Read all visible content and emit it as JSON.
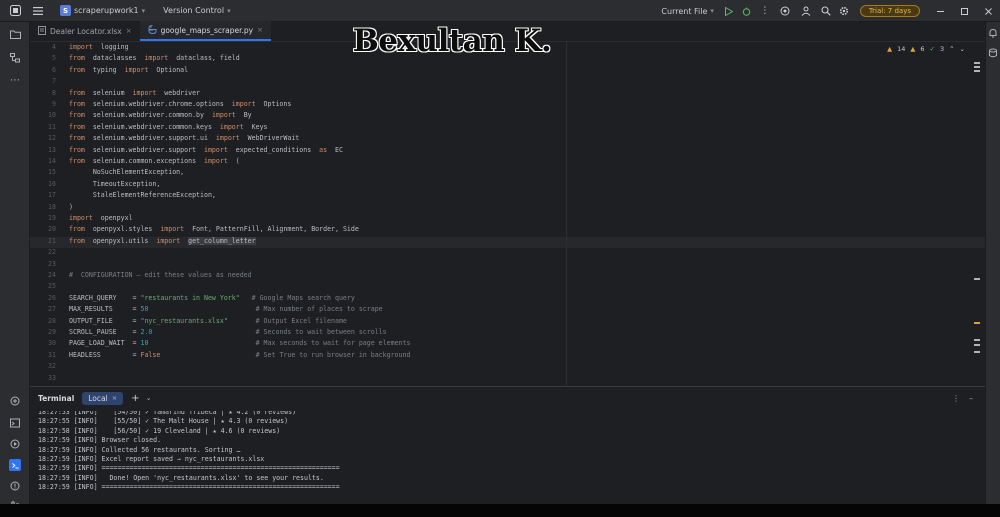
{
  "titlebar": {
    "project_badge": "S",
    "project_name": "scraperupwork1",
    "vcs_label": "Version Control",
    "run_config": "Current File",
    "trial_label": "Trial: 7 days",
    "icons": [
      "hamburger-menu-icon",
      "run-icon",
      "debug-icon",
      "more-icon",
      "ai-assistant-icon",
      "account-icon",
      "search-icon",
      "settings-icon",
      "minimize-icon",
      "maximize-icon",
      "close-icon"
    ]
  },
  "tabs": [
    {
      "label": "Dealer Locator.xlsx",
      "active": false
    },
    {
      "label": "google_maps_scraper.py",
      "active": true
    }
  ],
  "editor": {
    "inspections": {
      "warnings": "14",
      "weak": "6",
      "ok": "3"
    },
    "lines": [
      {
        "n": "4",
        "parts": [
          [
            "kw",
            "import"
          ],
          [
            "",
            "  logging"
          ]
        ]
      },
      {
        "n": "5",
        "parts": [
          [
            "kw",
            "from"
          ],
          [
            "",
            "  dataclasses  "
          ],
          [
            "kw",
            "import"
          ],
          [
            "",
            "  dataclass, field"
          ]
        ]
      },
      {
        "n": "6",
        "parts": [
          [
            "kw",
            "from"
          ],
          [
            "",
            "  typing  "
          ],
          [
            "kw",
            "import"
          ],
          [
            "",
            "  Optional"
          ]
        ]
      },
      {
        "n": "7",
        "parts": []
      },
      {
        "n": "8",
        "parts": [
          [
            "kw",
            "from"
          ],
          [
            "",
            "  selenium  "
          ],
          [
            "kw",
            "import"
          ],
          [
            "",
            "  webdriver"
          ]
        ]
      },
      {
        "n": "9",
        "parts": [
          [
            "kw",
            "from"
          ],
          [
            "",
            "  selenium.webdriver.chrome.options  "
          ],
          [
            "kw",
            "import"
          ],
          [
            "",
            "  Options"
          ]
        ]
      },
      {
        "n": "10",
        "parts": [
          [
            "kw",
            "from"
          ],
          [
            "",
            "  selenium.webdriver.common.by  "
          ],
          [
            "kw",
            "import"
          ],
          [
            "",
            "  By"
          ]
        ]
      },
      {
        "n": "11",
        "parts": [
          [
            "kw",
            "from"
          ],
          [
            "",
            "  selenium.webdriver.common.keys  "
          ],
          [
            "kw",
            "import"
          ],
          [
            "",
            "  Keys"
          ]
        ]
      },
      {
        "n": "12",
        "parts": [
          [
            "kw",
            "from"
          ],
          [
            "",
            "  selenium.webdriver.support.ui  "
          ],
          [
            "kw",
            "import"
          ],
          [
            "",
            "  WebDriverWait"
          ]
        ]
      },
      {
        "n": "13",
        "parts": [
          [
            "kw",
            "from"
          ],
          [
            "",
            "  selenium.webdriver.support  "
          ],
          [
            "kw",
            "import"
          ],
          [
            "",
            "  expected_conditions  "
          ],
          [
            "kw",
            "as"
          ],
          [
            "",
            "  EC"
          ]
        ]
      },
      {
        "n": "14",
        "parts": [
          [
            "kw",
            "from"
          ],
          [
            "",
            "  selenium.common.exceptions  "
          ],
          [
            "kw",
            "import"
          ],
          [
            "",
            "  ("
          ]
        ]
      },
      {
        "n": "15",
        "parts": [
          [
            "",
            "      NoSuchElementException,"
          ]
        ]
      },
      {
        "n": "16",
        "parts": [
          [
            "",
            "      TimeoutException,"
          ]
        ]
      },
      {
        "n": "17",
        "parts": [
          [
            "",
            "      StaleElementReferenceException,"
          ]
        ]
      },
      {
        "n": "18",
        "parts": [
          [
            "",
            ")"
          ]
        ]
      },
      {
        "n": "19",
        "parts": [
          [
            "kw",
            "import"
          ],
          [
            "",
            "  openpyxl"
          ]
        ]
      },
      {
        "n": "20",
        "parts": [
          [
            "kw",
            "from"
          ],
          [
            "",
            "  openpyxl.styles  "
          ],
          [
            "kw",
            "import"
          ],
          [
            "",
            "  Font, PatternFill, Alignment, Border, Side"
          ]
        ]
      },
      {
        "n": "21",
        "parts": [
          [
            "kw",
            "from"
          ],
          [
            "",
            "  openpyxl.utils  "
          ],
          [
            "kw",
            "import"
          ],
          [
            "",
            "  "
          ],
          [
            "hl",
            "get_column_letter"
          ]
        ]
      },
      {
        "n": "22",
        "parts": []
      },
      {
        "n": "23",
        "parts": []
      },
      {
        "n": "24",
        "parts": [
          [
            "cm",
            "#  CONFIGURATION — edit these values as needed"
          ]
        ]
      },
      {
        "n": "25",
        "parts": []
      },
      {
        "n": "26",
        "parts": [
          [
            "",
            "SEARCH_QUERY    = "
          ],
          [
            "st",
            "\"restaurants in New York\""
          ],
          [
            "cm",
            "   # Google Maps search query"
          ]
        ]
      },
      {
        "n": "27",
        "parts": [
          [
            "",
            "MAX_RESULTS     = "
          ],
          [
            "nu",
            "50"
          ],
          [
            "cm",
            "                           # Max number of places to scrape"
          ]
        ]
      },
      {
        "n": "28",
        "parts": [
          [
            "",
            "OUTPUT_FILE     = "
          ],
          [
            "st",
            "\"nyc_restaurants.xlsx\""
          ],
          [
            "cm",
            "       # Output Excel filename"
          ]
        ]
      },
      {
        "n": "29",
        "parts": [
          [
            "",
            "SCROLL_PAUSE    = "
          ],
          [
            "nu",
            "2.0"
          ],
          [
            "cm",
            "                          # Seconds to wait between scrolls"
          ]
        ]
      },
      {
        "n": "30",
        "parts": [
          [
            "",
            "PAGE_LOAD_WAIT  = "
          ],
          [
            "nu",
            "10"
          ],
          [
            "cm",
            "                           # Max seconds to wait for page elements"
          ]
        ]
      },
      {
        "n": "31",
        "parts": [
          [
            "",
            "HEADLESS        = "
          ],
          [
            "kw",
            "False"
          ],
          [
            "cm",
            "                        # Set True to run browser in background"
          ]
        ]
      },
      {
        "n": "32",
        "parts": []
      },
      {
        "n": "33",
        "parts": []
      }
    ]
  },
  "terminal": {
    "title": "Terminal",
    "tab_label": "Local",
    "lines": [
      "18:27:53 [INFO]    [54/50] ✓ Tamarind Tribeca | ★ 4.2 (0 reviews)",
      "18:27:55 [INFO]    [55/50] ✓ The Malt House | ★ 4.3 (0 reviews)",
      "18:27:58 [INFO]    [56/50] ✓ 19 Cleveland | ★ 4.6 (0 reviews)",
      "18:27:59 [INFO] Browser closed.",
      "18:27:59 [INFO] Collected 56 restaurants. Sorting …",
      "18:27:59 [INFO] Excel report saved → nyc_restaurants.xlsx",
      "18:27:59 [INFO] ============================================================",
      "18:27:59 [INFO]   Done! Open 'nyc_restaurants.xlsx' to see your results.",
      "18:27:59 [INFO] ============================================================"
    ]
  },
  "watermark": "Bexultan K."
}
